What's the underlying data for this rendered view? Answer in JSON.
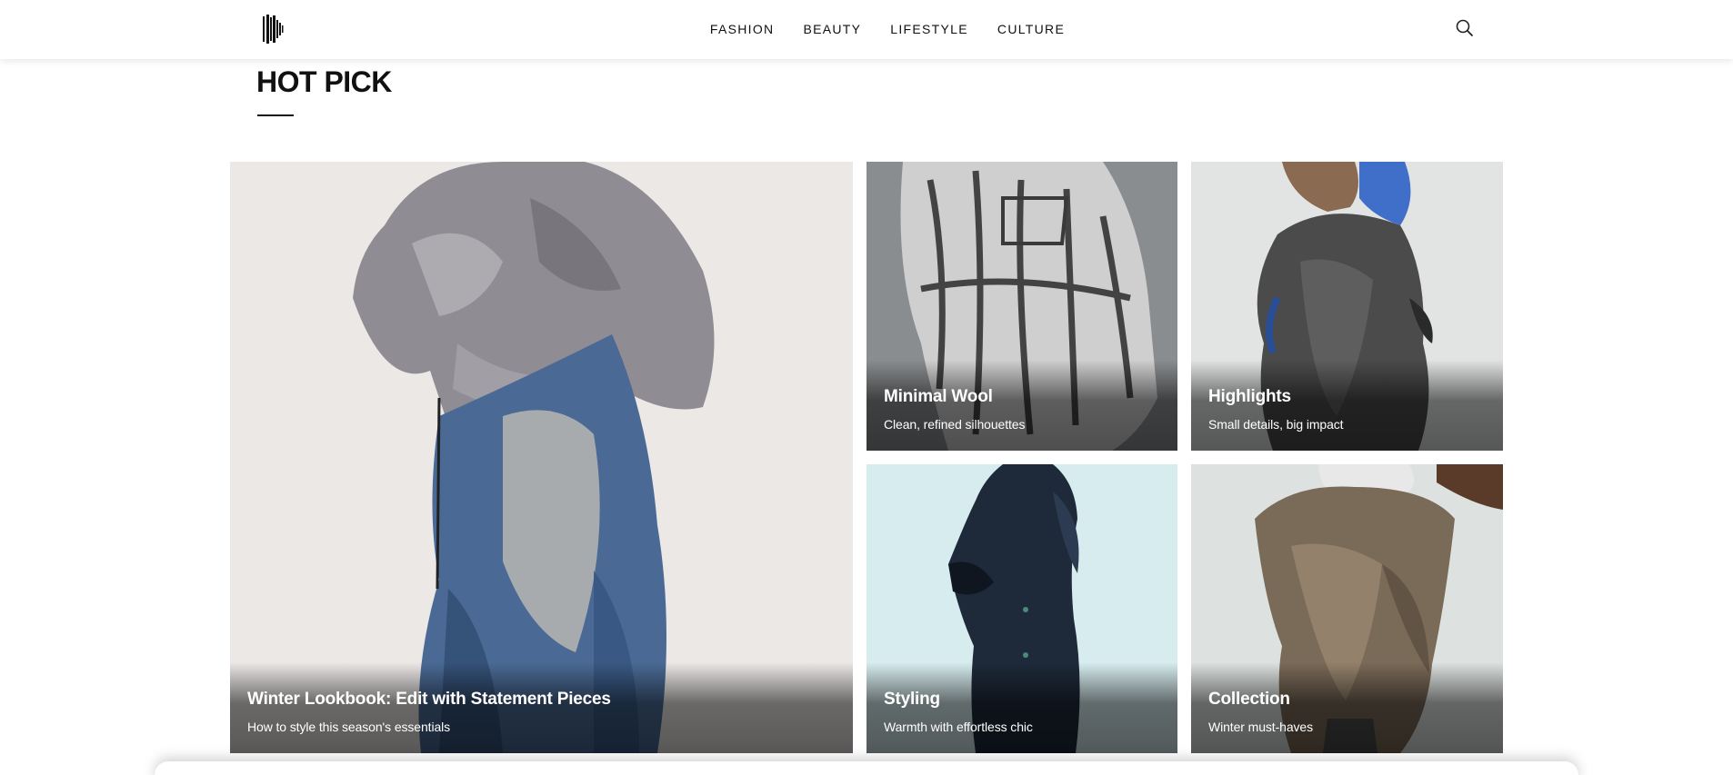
{
  "header": {
    "logo_icon": "brand-logo-icon",
    "nav": [
      {
        "label": "FASHION"
      },
      {
        "label": "BEAUTY"
      },
      {
        "label": "LIFESTYLE"
      },
      {
        "label": "CULTURE"
      }
    ],
    "search_icon": "search-icon"
  },
  "section": {
    "title": "HOT PICK"
  },
  "cards": [
    {
      "title": "Winter Lookbook: Edit with Statement Pieces",
      "subtitle": "How to style this season's essentials"
    },
    {
      "title": "Minimal Wool",
      "subtitle": "Clean, refined silhouettes"
    },
    {
      "title": "Highlights",
      "subtitle": "Small details, big impact"
    },
    {
      "title": "Styling",
      "subtitle": "Warmth with effortless chic"
    },
    {
      "title": "Collection",
      "subtitle": "Winter must-haves"
    }
  ]
}
